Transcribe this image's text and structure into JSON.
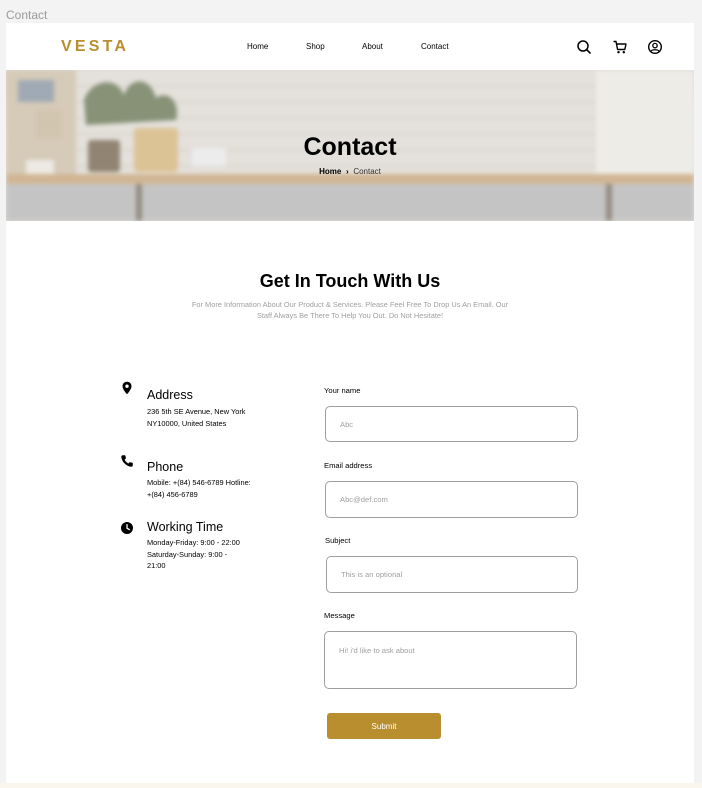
{
  "frame": {
    "label": "Contact"
  },
  "brand": {
    "logo": "VESTA",
    "accent_color": "#b88e2f"
  },
  "nav": {
    "items": [
      {
        "label": "Home"
      },
      {
        "label": "Shop"
      },
      {
        "label": "About"
      },
      {
        "label": "Contact"
      }
    ],
    "icons": [
      "search-icon",
      "cart-icon",
      "user-icon"
    ]
  },
  "hero": {
    "title": "Contact",
    "breadcrumb": {
      "home": "Home",
      "current": "Contact"
    }
  },
  "intro": {
    "title": "Get In Touch With Us",
    "text": "For More Information About Our Product & Services. Please Feel Free To Drop Us An Email. Our Staff Always Be There To Help You Out. Do Not Hesitate!"
  },
  "info": [
    {
      "icon": "location-pin-icon",
      "title": "Address",
      "lines": "236 5th SE Avenue, New York NY10000, United States"
    },
    {
      "icon": "phone-icon",
      "title": "Phone",
      "lines": "Mobile: +(84) 546-6789 Hotline: +(84) 456-6789"
    },
    {
      "icon": "clock-icon",
      "title": "Working Time",
      "lines": "Monday-Friday: 9:00 - 22:00 Saturday-Sunday: 9:00 - 21:00"
    }
  ],
  "form": {
    "name": {
      "label": "Your name",
      "placeholder": "Abc"
    },
    "email": {
      "label": "Email address",
      "placeholder": "Abc@def.com"
    },
    "subject": {
      "label": "Subject",
      "placeholder": "This is an optional"
    },
    "message": {
      "label": "Message",
      "placeholder": "Hi! i'd like to ask about"
    },
    "submit": "Submit"
  }
}
